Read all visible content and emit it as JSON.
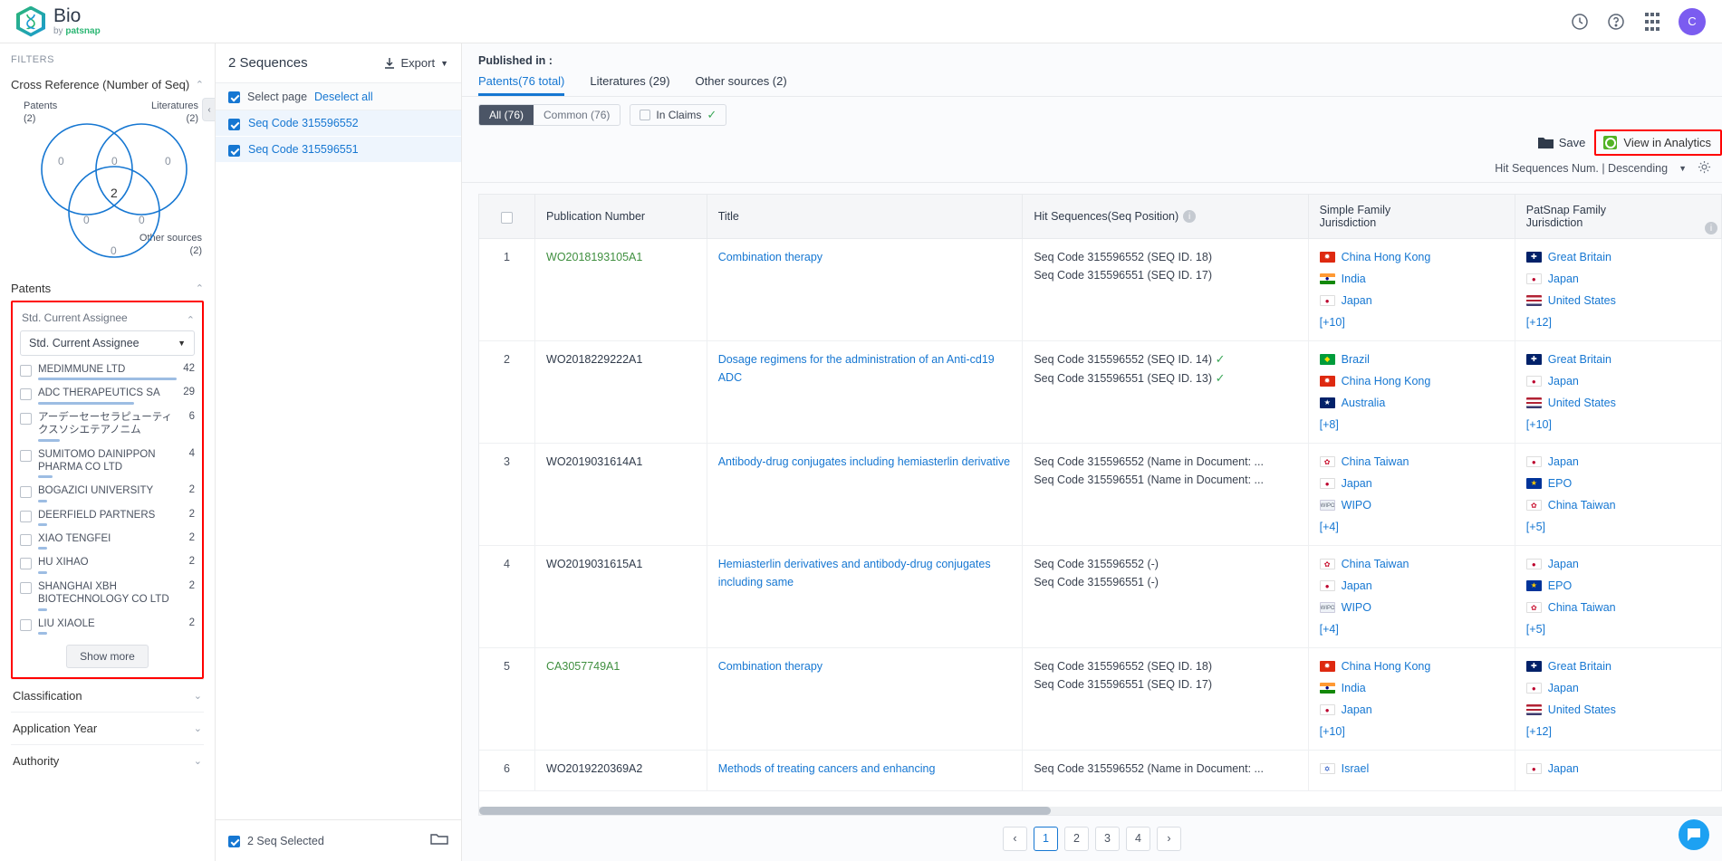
{
  "brand": {
    "name": "Bio",
    "by_prefix": "by ",
    "by_name": "patsnap"
  },
  "topbar": {
    "history_icon": "history-icon",
    "help_icon": "help-icon",
    "apps_icon": "apps-grid-icon",
    "avatar_initial": "C"
  },
  "filters": {
    "title": "FILTERS",
    "cross_reference_label": "Cross Reference  (Number of Seq)",
    "venn": {
      "patents_label": "Patents",
      "patents_count": "(2)",
      "literatures_label": "Literatures",
      "literatures_count": "(2)",
      "other_label": "Other sources",
      "other_count": "(2)",
      "v_patents_only": "0",
      "v_pat_lit": "0",
      "v_lit_only": "0",
      "v_center": "2",
      "v_pat_other": "0",
      "v_lit_other": "0",
      "v_other_only": "0"
    },
    "patents_section": "Patents",
    "assignee": {
      "label": "Std. Current Assignee",
      "select_value": "Std. Current Assignee",
      "items": [
        {
          "name": "MEDIMMUNE LTD",
          "count": "42",
          "bar": 100
        },
        {
          "name": "ADC THERAPEUTICS SA",
          "count": "29",
          "bar": 69
        },
        {
          "name": "アーデーセーセラピューティクスソシエテアノニム",
          "count": "6",
          "bar": 15
        },
        {
          "name": "SUMITOMO DAINIPPON PHARMA CO LTD",
          "count": "4",
          "bar": 10
        },
        {
          "name": "BOGAZICI UNIVERSITY",
          "count": "2",
          "bar": 6
        },
        {
          "name": "DEERFIELD PARTNERS",
          "count": "2",
          "bar": 6
        },
        {
          "name": "XIAO TENGFEI",
          "count": "2",
          "bar": 6
        },
        {
          "name": "HU XIHAO",
          "count": "2",
          "bar": 6
        },
        {
          "name": "SHANGHAI XBH BIOTECHNOLOGY CO LTD",
          "count": "2",
          "bar": 6
        },
        {
          "name": "LIU XIAOLE",
          "count": "2",
          "bar": 6
        }
      ],
      "show_more": "Show more"
    },
    "sections": [
      {
        "label": "Classification"
      },
      {
        "label": "Application Year"
      },
      {
        "label": "Authority"
      }
    ]
  },
  "sequences": {
    "count_label": "2 Sequences",
    "export_label": "Export",
    "select_page": "Select page",
    "deselect_all": "Deselect all",
    "items": [
      {
        "label": "Seq Code 315596552"
      },
      {
        "label": "Seq Code 315596551"
      }
    ],
    "footer_label": "2 Seq Selected",
    "folder_icon": "folder-icon"
  },
  "main": {
    "published_in": "Published in :",
    "tabs": [
      {
        "label": "Patents(76 total)",
        "active": true
      },
      {
        "label": "Literatures (29)",
        "active": false
      },
      {
        "label": "Other sources (2)",
        "active": false
      }
    ],
    "segments": [
      {
        "label": "All (76)",
        "active": true
      },
      {
        "label": "Common (76)",
        "active": false
      }
    ],
    "in_claims": "In Claims",
    "save_label": "Save",
    "view_analytics_label": "View in Analytics",
    "sort_label": "Hit Sequences Num. | Descending",
    "gear_icon": "gear-icon"
  },
  "table": {
    "columns": [
      {
        "key": "chk",
        "label": ""
      },
      {
        "key": "pub",
        "label": "Publication Number"
      },
      {
        "key": "title",
        "label": "Title"
      },
      {
        "key": "hit",
        "label": "Hit Sequences(Seq Position)"
      },
      {
        "key": "simple",
        "label": "Simple Family\nJurisdiction"
      },
      {
        "key": "patsnap",
        "label": "PatSnap Family\nJurisdiction"
      }
    ],
    "col_simple_l1": "Simple Family",
    "col_simple_l2": "Jurisdiction",
    "col_patsnap_l1": "PatSnap Family",
    "col_patsnap_l2": "Jurisdiction",
    "rows": [
      {
        "idx": "1",
        "pub": "WO2018193105A1",
        "pub_color": "green",
        "title": "Combination therapy",
        "hits": [
          {
            "text": "Seq Code 315596552 (SEQ ID. 18)",
            "check": false
          },
          {
            "text": "Seq Code 315596551 (SEQ ID. 17)",
            "check": false
          }
        ],
        "simple": [
          {
            "flag": "hk",
            "name": "China Hong Kong"
          },
          {
            "flag": "in",
            "name": "India"
          },
          {
            "flag": "jp",
            "name": "Japan"
          }
        ],
        "simple_more": "[+10]",
        "patsnap": [
          {
            "flag": "gb",
            "name": "Great Britain"
          },
          {
            "flag": "jp",
            "name": "Japan"
          },
          {
            "flag": "us",
            "name": "United States"
          }
        ],
        "patsnap_more": "[+12]"
      },
      {
        "idx": "2",
        "pub": "WO2018229222A1",
        "pub_color": "dark",
        "title": "Dosage regimens for the administration of an Anti-cd19 ADC",
        "hits": [
          {
            "text": "Seq Code 315596552 (SEQ ID. 14)",
            "check": true
          },
          {
            "text": "Seq Code 315596551 (SEQ ID. 13)",
            "check": true
          }
        ],
        "simple": [
          {
            "flag": "br",
            "name": "Brazil"
          },
          {
            "flag": "hk",
            "name": "China Hong Kong"
          },
          {
            "flag": "au",
            "name": "Australia"
          }
        ],
        "simple_more": "[+8]",
        "patsnap": [
          {
            "flag": "gb",
            "name": "Great Britain"
          },
          {
            "flag": "jp",
            "name": "Japan"
          },
          {
            "flag": "us",
            "name": "United States"
          }
        ],
        "patsnap_more": "[+10]"
      },
      {
        "idx": "3",
        "pub": "WO2019031614A1",
        "pub_color": "dark",
        "title": "Antibody-drug conjugates including hemiasterlin derivative",
        "hits": [
          {
            "text": "Seq Code 315596552 (Name in Document: ...",
            "check": false
          },
          {
            "text": "Seq Code 315596551 (Name in Document: ...",
            "check": false
          }
        ],
        "simple": [
          {
            "flag": "tw",
            "name": "China Taiwan"
          },
          {
            "flag": "jp",
            "name": "Japan"
          },
          {
            "flag": "wo",
            "name": "WIPO"
          }
        ],
        "simple_more": "[+4]",
        "patsnap": [
          {
            "flag": "jp",
            "name": "Japan"
          },
          {
            "flag": "ep",
            "name": "EPO"
          },
          {
            "flag": "tw",
            "name": "China Taiwan"
          }
        ],
        "patsnap_more": "[+5]"
      },
      {
        "idx": "4",
        "pub": "WO2019031615A1",
        "pub_color": "dark",
        "title": "Hemiasterlin derivatives and antibody-drug conjugates including same",
        "hits": [
          {
            "text": "Seq Code 315596552 (-)",
            "check": false
          },
          {
            "text": "Seq Code 315596551 (-)",
            "check": false
          }
        ],
        "simple": [
          {
            "flag": "tw",
            "name": "China Taiwan"
          },
          {
            "flag": "jp",
            "name": "Japan"
          },
          {
            "flag": "wo",
            "name": "WIPO"
          }
        ],
        "simple_more": "[+4]",
        "patsnap": [
          {
            "flag": "jp",
            "name": "Japan"
          },
          {
            "flag": "ep",
            "name": "EPO"
          },
          {
            "flag": "tw",
            "name": "China Taiwan"
          }
        ],
        "patsnap_more": "[+5]"
      },
      {
        "idx": "5",
        "pub": "CA3057749A1",
        "pub_color": "green",
        "title": "Combination therapy",
        "hits": [
          {
            "text": "Seq Code 315596552 (SEQ ID. 18)",
            "check": false
          },
          {
            "text": "Seq Code 315596551 (SEQ ID. 17)",
            "check": false
          }
        ],
        "simple": [
          {
            "flag": "hk",
            "name": "China Hong Kong"
          },
          {
            "flag": "in",
            "name": "India"
          },
          {
            "flag": "jp",
            "name": "Japan"
          }
        ],
        "simple_more": "[+10]",
        "patsnap": [
          {
            "flag": "gb",
            "name": "Great Britain"
          },
          {
            "flag": "jp",
            "name": "Japan"
          },
          {
            "flag": "us",
            "name": "United States"
          }
        ],
        "patsnap_more": "[+12]"
      },
      {
        "idx": "6",
        "pub": "WO2019220369A2",
        "pub_color": "dark",
        "title": "Methods of treating cancers and enhancing",
        "hits": [
          {
            "text": "Seq Code 315596552 (Name in Document: ...",
            "check": false
          }
        ],
        "simple": [
          {
            "flag": "il",
            "name": "Israel"
          }
        ],
        "simple_more": "",
        "patsnap": [
          {
            "flag": "jp",
            "name": "Japan"
          }
        ],
        "patsnap_more": ""
      }
    ]
  },
  "pagination": {
    "prev": "‹",
    "next": "›",
    "pages": [
      "1",
      "2",
      "3",
      "4"
    ],
    "current": "1"
  },
  "colors": {
    "accent": "#1677d2",
    "green": "#3f8f3f",
    "highlight_border": "#ff0000",
    "bar": "#9dbde3"
  }
}
